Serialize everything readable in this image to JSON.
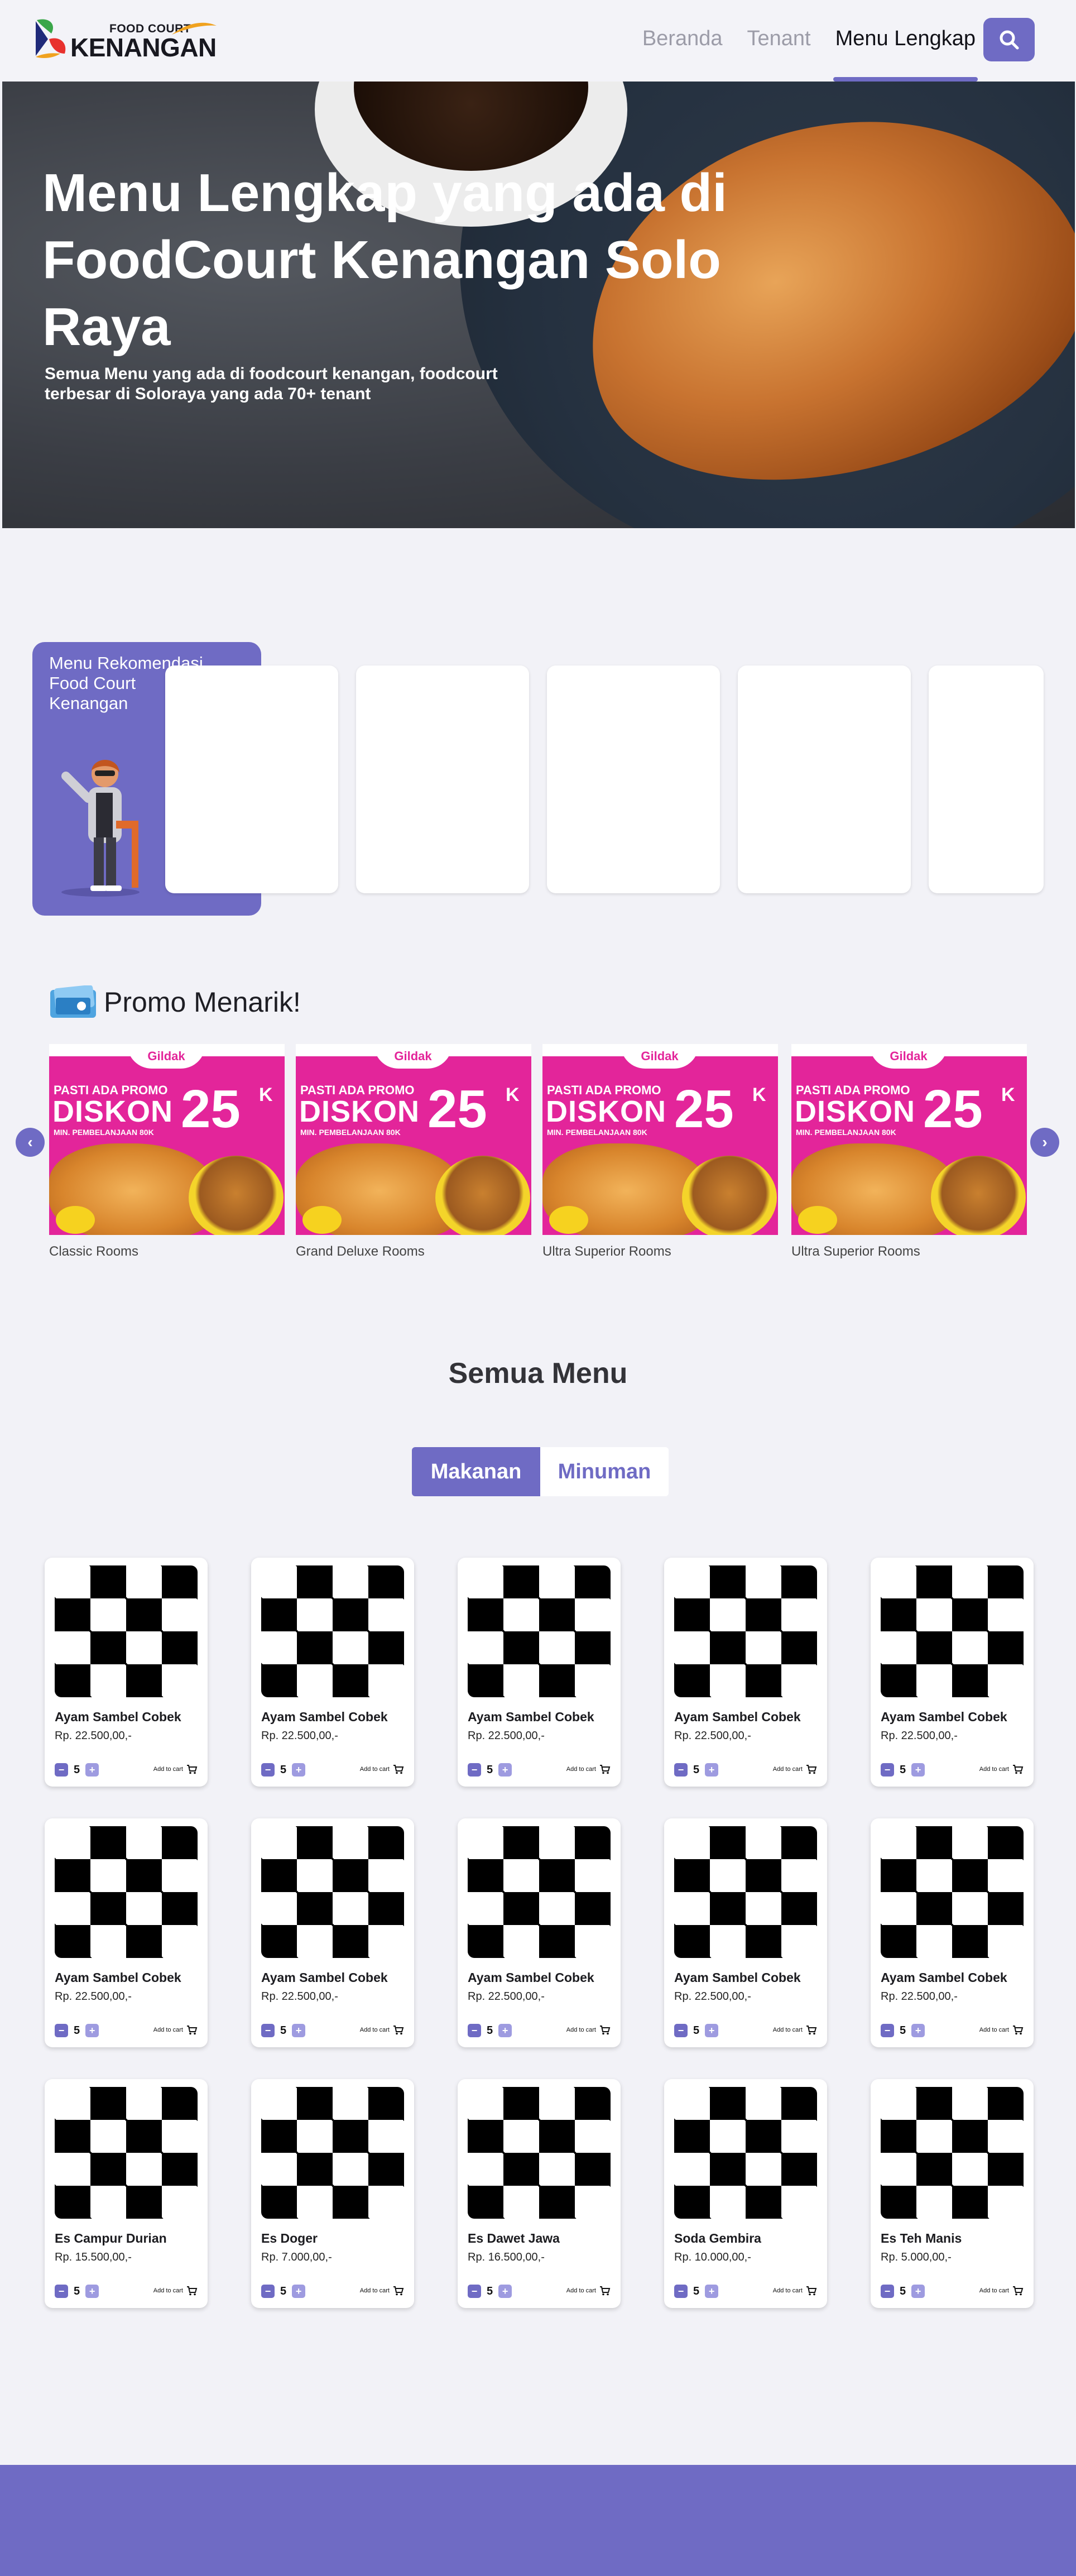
{
  "navbar": {
    "logo_top": "FOOD COURT",
    "logo_main": "KENANGAN",
    "links": [
      {
        "label": "Beranda",
        "active": false
      },
      {
        "label": "Tenant",
        "active": false
      },
      {
        "label": "Menu Lengkap",
        "active": true
      }
    ],
    "search_icon": "search-icon",
    "accent_color": "#6f6bc4"
  },
  "hero": {
    "title": "Menu Lengkap yang ada di FoodCourt Kenangan Solo Raya",
    "subtitle": "Semua Menu yang ada di foodcourt kenangan, foodcourt terbesar di Soloraya yang ada 70+ tenant"
  },
  "recommendation": {
    "title": "Menu Rekomendasi Food Court Kenangan"
  },
  "promo": {
    "title": "Promo Menarik!",
    "banner": {
      "brand": "Gildak",
      "line1": "PASTI ADA PROMO",
      "line2": "DISKON",
      "line3": "MIN. PEMBELANJAAN 80K",
      "amount": "25",
      "unit": "K"
    },
    "items": [
      {
        "caption": "Classic Rooms"
      },
      {
        "caption": "Grand Deluxe Rooms"
      },
      {
        "caption": "Ultra Superior Rooms"
      },
      {
        "caption": "Ultra Superior Rooms"
      }
    ],
    "prev_icon": "chevron-left-icon",
    "next_icon": "chevron-right-icon",
    "prev_symbol": "‹",
    "next_symbol": "›"
  },
  "menu": {
    "title": "Semua Menu",
    "tabs": [
      {
        "label": "Makanan",
        "active": true
      },
      {
        "label": "Minuman",
        "active": false
      }
    ],
    "minus_symbol": "−",
    "plus_symbol": "+",
    "add_to_cart_label": "Add to cart",
    "items": [
      {
        "name": "Ayam Sambel Cobek",
        "price": "Rp. 22.500,00,-",
        "qty": "5"
      },
      {
        "name": "Ayam Sambel Cobek",
        "price": "Rp. 22.500,00,-",
        "qty": "5"
      },
      {
        "name": "Ayam Sambel Cobek",
        "price": "Rp. 22.500,00,-",
        "qty": "5"
      },
      {
        "name": "Ayam Sambel Cobek",
        "price": "Rp. 22.500,00,-",
        "qty": "5"
      },
      {
        "name": "Ayam Sambel Cobek",
        "price": "Rp. 22.500,00,-",
        "qty": "5"
      },
      {
        "name": "Ayam Sambel Cobek",
        "price": "Rp. 22.500,00,-",
        "qty": "5"
      },
      {
        "name": "Ayam Sambel Cobek",
        "price": "Rp. 22.500,00,-",
        "qty": "5"
      },
      {
        "name": "Ayam Sambel Cobek",
        "price": "Rp. 22.500,00,-",
        "qty": "5"
      },
      {
        "name": "Ayam Sambel Cobek",
        "price": "Rp. 22.500,00,-",
        "qty": "5"
      },
      {
        "name": "Ayam Sambel Cobek",
        "price": "Rp. 22.500,00,-",
        "qty": "5"
      },
      {
        "name": "Es Campur Durian",
        "price": "Rp. 15.500,00,-",
        "qty": "5"
      },
      {
        "name": "Es Doger",
        "price": "Rp. 7.000,00,-",
        "qty": "5"
      },
      {
        "name": "Es Dawet Jawa",
        "price": "Rp. 16.500,00,-",
        "qty": "5"
      },
      {
        "name": "Soda Gembira",
        "price": "Rp. 10.000,00,-",
        "qty": "5"
      },
      {
        "name": "Es Teh Manis",
        "price": "Rp. 5.000,00,-",
        "qty": "5"
      }
    ]
  }
}
